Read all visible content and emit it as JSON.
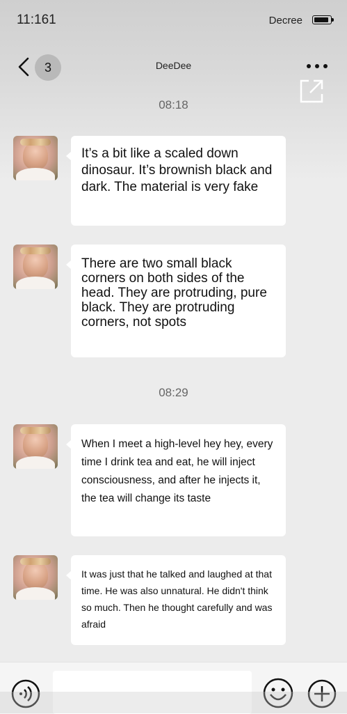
{
  "status_bar": {
    "time": "11:161",
    "carrier": "Decree",
    "battery_icon": "battery-full-icon"
  },
  "nav": {
    "back_icon": "chevron-left-icon",
    "unread_count": "3",
    "title": "DeeDee",
    "more_icon": "more-dots-icon",
    "share_icon": "share-external-icon"
  },
  "chat": {
    "timestamps": [
      "08:18",
      "08:29"
    ],
    "messages": [
      {
        "sender": "DeeDee",
        "text": "It’s a bit like a scaled down dinosaur. It’s brownish black and dark. The material is very fake"
      },
      {
        "sender": "DeeDee",
        "text": "There are two small black corners on both sides of the head. They are protruding, pure black. They are protruding corners, not spots"
      },
      {
        "sender": "DeeDee",
        "text": "When I meet a high-level hey hey, every time I drink tea and eat, he will inject consciousness, and after he injects it, the tea will change its taste"
      },
      {
        "sender": "DeeDee",
        "text": "It was just that he talked and laughed at that time. He was also unnatural. He didn't think so much. Then he thought carefully and was afraid"
      }
    ]
  },
  "input_bar": {
    "voice_icon": "voice-icon",
    "input_value": "",
    "emoji_icon": "emoji-icon",
    "plus_icon": "plus-circle-icon"
  },
  "colors": {
    "background": "#ececec",
    "bubble": "#ffffff",
    "badge": "#b9b9b9"
  }
}
